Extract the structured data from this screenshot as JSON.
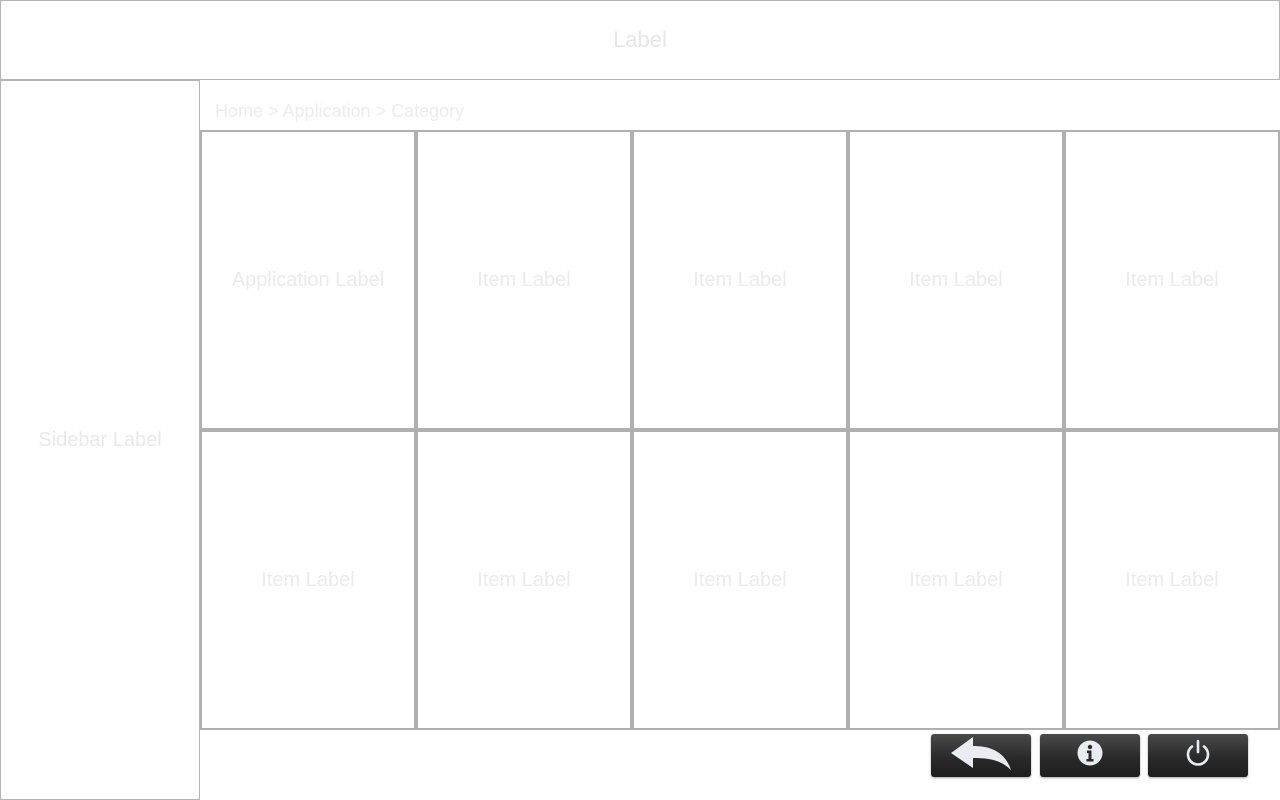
{
  "header": {
    "title": "Label"
  },
  "sidebar": {
    "label": "Sidebar Label"
  },
  "breadcrumb": {
    "text": "Home > Application > Category"
  },
  "tiles": [
    {
      "label": "Application Label"
    },
    {
      "label": "Item Label"
    },
    {
      "label": "Item Label"
    },
    {
      "label": "Item Label"
    },
    {
      "label": "Item Label"
    },
    {
      "label": "Item Label"
    },
    {
      "label": "Item Label"
    },
    {
      "label": "Item Label"
    },
    {
      "label": "Item Label"
    },
    {
      "label": "Item Label"
    }
  ],
  "footer": {
    "back_icon": "back-arrow-icon",
    "info_icon": "info-icon",
    "power_icon": "power-icon"
  },
  "colors": {
    "button_bg": "#2a2a2a",
    "icon": "#e9edf2",
    "border": "#b0b0b0"
  }
}
